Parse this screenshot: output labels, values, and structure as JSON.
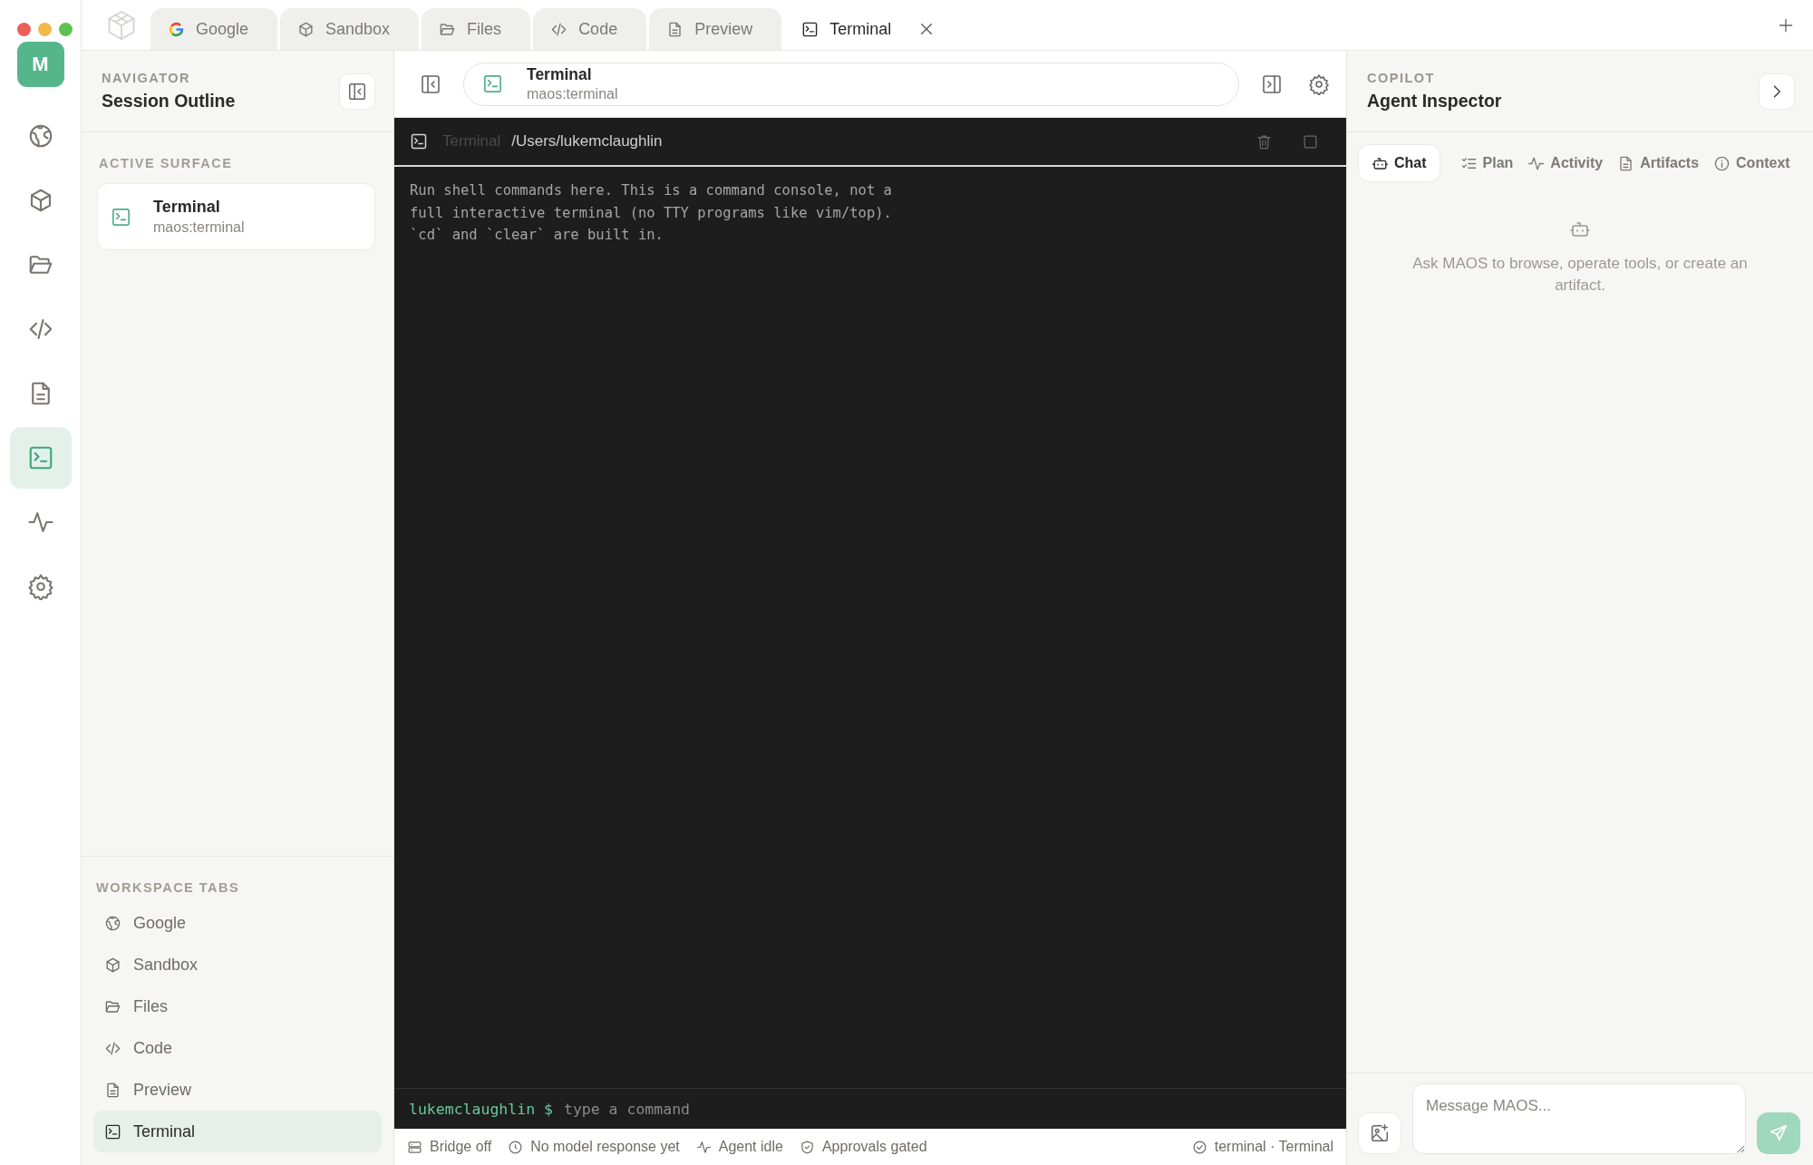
{
  "rail": {
    "avatar": "M",
    "items": [
      {
        "kind": "web",
        "selected": false
      },
      {
        "kind": "sandbox",
        "selected": false
      },
      {
        "kind": "files",
        "selected": false
      },
      {
        "kind": "code",
        "selected": false
      },
      {
        "kind": "preview",
        "selected": false
      },
      {
        "kind": "terminal",
        "selected": true
      },
      {
        "kind": "activity",
        "selected": false
      },
      {
        "kind": "settings",
        "selected": false
      }
    ]
  },
  "tabs": [
    {
      "label": "Google",
      "kind": "google",
      "selected": false
    },
    {
      "label": "Sandbox",
      "kind": "sandbox",
      "selected": false
    },
    {
      "label": "Files",
      "kind": "files",
      "selected": false
    },
    {
      "label": "Code",
      "kind": "code",
      "selected": false
    },
    {
      "label": "Preview",
      "kind": "preview",
      "selected": false
    },
    {
      "label": "Terminal",
      "kind": "terminal",
      "selected": true
    }
  ],
  "navigator": {
    "label": "NAVIGATOR",
    "title": "Session Outline",
    "active_surface": {
      "heading": "ACTIVE SURFACE",
      "title": "Terminal",
      "subtitle": "maos:terminal"
    },
    "workspace_tabs": {
      "heading": "WORKSPACE TABS",
      "items": [
        {
          "label": "Google",
          "kind": "web",
          "selected": false
        },
        {
          "label": "Sandbox",
          "kind": "sandbox",
          "selected": false
        },
        {
          "label": "Files",
          "kind": "files",
          "selected": false
        },
        {
          "label": "Code",
          "kind": "code",
          "selected": false
        },
        {
          "label": "Preview",
          "kind": "preview",
          "selected": false
        },
        {
          "label": "Terminal",
          "kind": "terminal",
          "selected": true
        }
      ]
    }
  },
  "address": {
    "title": "Terminal",
    "subtitle": "maos:terminal"
  },
  "terminal": {
    "title": "Terminal",
    "path": "/Users/lukemclaughlin",
    "lines": [
      "Run shell commands here. This is a command console, not a",
      "full interactive terminal (no TTY programs like vim/top).",
      "`cd` and `clear` are built in."
    ],
    "prompt": "lukemclaughlin $",
    "placeholder": "type a command"
  },
  "status_bar": {
    "items": [
      {
        "kind": "bridge",
        "text": "Bridge off"
      },
      {
        "kind": "model",
        "text": "No model response yet"
      },
      {
        "kind": "agent",
        "text": "Agent idle"
      },
      {
        "kind": "approvals",
        "text": "Approvals gated"
      }
    ],
    "right": "terminal · Terminal"
  },
  "copilot": {
    "label": "COPILOT",
    "title": "Agent Inspector",
    "tabs": [
      {
        "label": "Chat",
        "kind": "chat",
        "selected": true
      },
      {
        "label": "Plan",
        "kind": "plan",
        "selected": false
      },
      {
        "label": "Activity",
        "kind": "activity",
        "selected": false
      },
      {
        "label": "Artifacts",
        "kind": "artifacts",
        "selected": false
      },
      {
        "label": "Context",
        "kind": "context",
        "selected": false
      }
    ],
    "empty_message": "Ask MAOS to browse, operate tools, or create an artifact.",
    "composer": {
      "placeholder": "Message MAOS..."
    }
  }
}
